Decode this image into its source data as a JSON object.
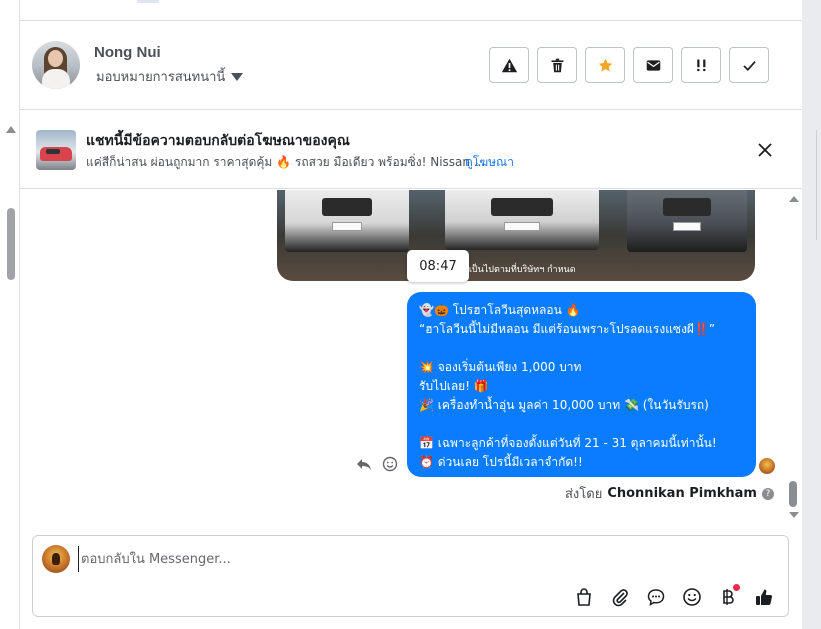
{
  "contact": {
    "name": "Nong Nui",
    "assign_label": "มอบหมายการสนทนานี้"
  },
  "actions": [
    {
      "name": "report-spam-button",
      "icon": "warning-triangle-icon"
    },
    {
      "name": "delete-button",
      "icon": "trash-icon"
    },
    {
      "name": "star-button",
      "icon": "star-icon"
    },
    {
      "name": "mark-unread-button",
      "icon": "envelope-icon"
    },
    {
      "name": "mark-important-button",
      "icon": "exclamation-icon"
    },
    {
      "name": "mark-done-button",
      "icon": "check-icon"
    }
  ],
  "ad_notice": {
    "title": "แชทนี้มีข้อความตอบกลับต่อโฆษณาของคุณ",
    "description": "แค่สีก็น่าสน ผ่อนถูกมาก ราคาสุดคุ้ม 🔥 รถสวย มือเดียว พร้อมซิ่ง! Nissan ...",
    "link": "ดูโฆษณา"
  },
  "conversation": {
    "image_caption": "นไข่เป็นไปตามที่บริษัทฯ กำหนด",
    "time": "08:47",
    "message_lines": [
      "👻🎃 โปรฮาโลวีนสุดหลอน 🔥",
      "“ฮาโลวีนนี้ไม่มีหลอน มีแต่ร้อนเพราะโปรลดแรงแซงผี‼️”",
      "",
      "💥 จองเริ่มต้นเพียง 1,000 บาท",
      "รับไปเลย! 🎁",
      "🎉 เครื่องทำน้ำอุ่น มูลค่า 10,000 บาท 💸 (ในวันรับรถ)",
      "",
      "📅 เฉพาะลูกค้าที่จองตั้งแต่วันที่ 21 - 31 ตุลาคมนี้เท่านั้น!",
      "⏰ ด่วนเลย โปรนี้มีเวลาจำกัด!!"
    ],
    "sent_by_label": "ส่งโดย",
    "sent_by_name": "Chonnikan Pimkham"
  },
  "composer": {
    "placeholder": "ตอบกลับใน Messenger..."
  },
  "colors": {
    "bubble": "#0a7cff",
    "link": "#1877f2",
    "star": "#f5a623",
    "badge": "#f02849"
  }
}
